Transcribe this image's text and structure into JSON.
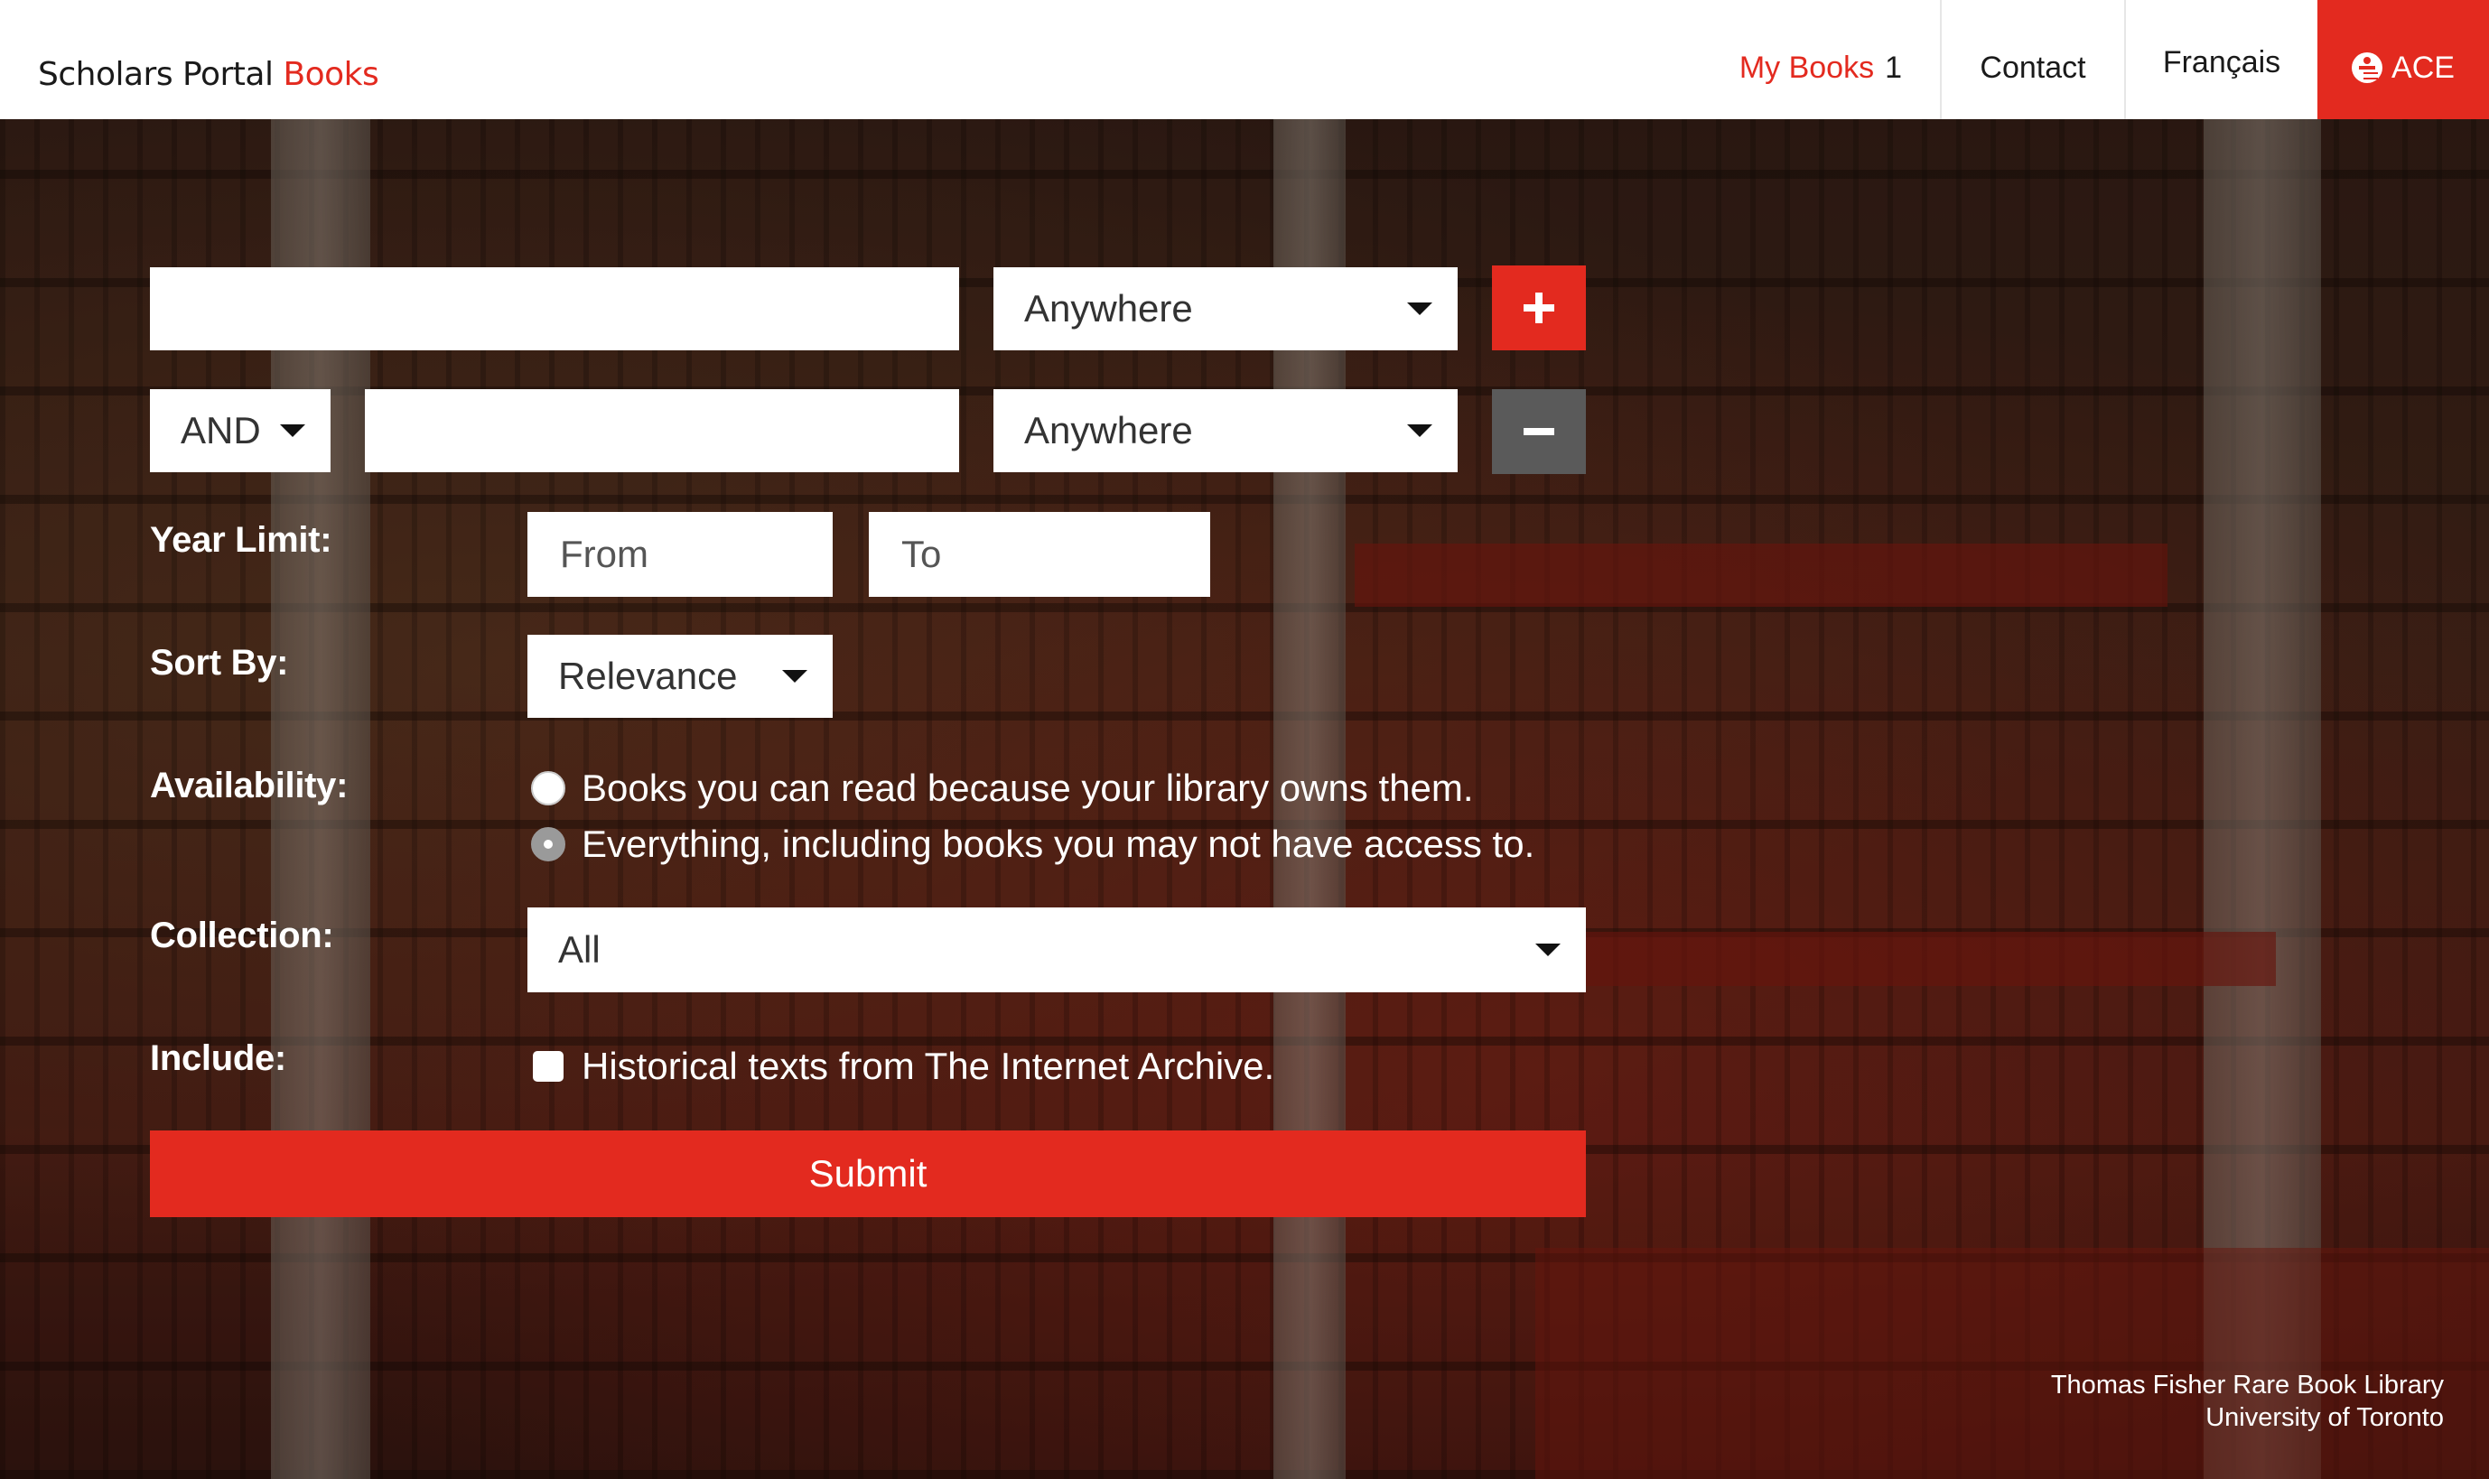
{
  "header": {
    "brand_main": "Scholars Portal",
    "brand_accent": "Books",
    "nav": {
      "mybooks_label": "My Books",
      "mybooks_count": "1",
      "contact_label": "Contact",
      "language_label": "Français",
      "accessibility_label": "ACE"
    }
  },
  "search": {
    "row1": {
      "query_value": "",
      "field_select": "Anywhere"
    },
    "row2": {
      "operator": "AND",
      "query_value": "",
      "field_select": "Anywhere"
    },
    "year_limit": {
      "label": "Year Limit:",
      "from_placeholder": "From",
      "to_placeholder": "To"
    },
    "sort": {
      "label": "Sort By:",
      "selected": "Relevance"
    },
    "availability": {
      "label": "Availability:",
      "options": [
        {
          "label": "Books you can read because your library owns them.",
          "checked": false
        },
        {
          "label": "Everything, including books you may not have access to.",
          "checked": true
        }
      ]
    },
    "collection": {
      "label": "Collection:",
      "selected": "All"
    },
    "include": {
      "label": "Include:",
      "option_label": "Historical texts from The Internet Archive.",
      "checked": false
    },
    "submit_label": "Submit"
  },
  "credit": {
    "line1": "Thomas Fisher Rare Book Library",
    "line2": "University of Toronto"
  },
  "colors": {
    "accent": "#e32a1f",
    "minus_button": "#5a5a5a",
    "header_bg": "#ffffff"
  },
  "icons": {
    "add_row": "plus-icon",
    "remove_row": "minus-icon",
    "dropdown": "caret-down-icon",
    "accessibility": "accessibility-icon"
  }
}
